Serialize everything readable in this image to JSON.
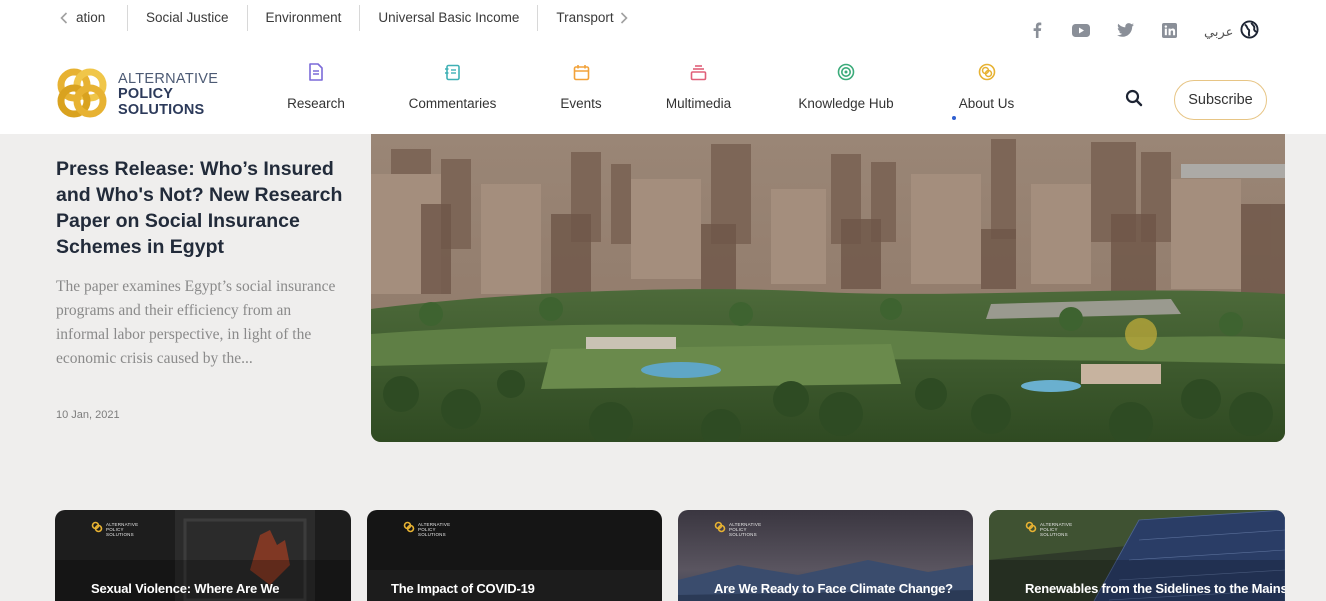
{
  "topics": {
    "items": [
      "ation",
      "Social Justice",
      "Environment",
      "Universal Basic Income",
      "Transport"
    ]
  },
  "social": {
    "icons": [
      "facebook-icon",
      "youtube-icon",
      "twitter-icon",
      "linkedin-icon"
    ],
    "language_label": "عربي"
  },
  "logo": {
    "line1": "ALTERNATIVE",
    "line2": "POLICY",
    "line3": "SOLUTIONS"
  },
  "nav": {
    "items": [
      {
        "label": "Research",
        "icon": "document-icon",
        "color": "#7b6ad8"
      },
      {
        "label": "Commentaries",
        "icon": "notebook-icon",
        "color": "#3fb0b5"
      },
      {
        "label": "Events",
        "icon": "calendar-icon",
        "color": "#f2a23a"
      },
      {
        "label": "Multimedia",
        "icon": "stack-icon",
        "color": "#e0607a"
      },
      {
        "label": "Knowledge Hub",
        "icon": "target-icon",
        "color": "#3bab7a"
      },
      {
        "label": "About Us",
        "icon": "logo-mark-icon",
        "color": "#e7b232"
      }
    ],
    "subscribe_label": "Subscribe"
  },
  "feature": {
    "title": "Press Release: Who’s Insured and Who's Not? New Research Paper on Social Insurance Schemes in Egypt",
    "excerpt": "The paper examines Egypt’s social insurance programs and their efficiency from an informal labor perspective, in light of the economic crisis caused by the...",
    "date": "10 Jan, 2021"
  },
  "cards": [
    {
      "title": "Sexual Violence: Where Are We",
      "logo_text": [
        "ALTERNATIVE",
        "POLICY",
        "SOLUTIONS"
      ]
    },
    {
      "title": "The Impact of COVID-19",
      "logo_text": [
        "ALTERNATIVE",
        "POLICY",
        "SOLUTIONS"
      ]
    },
    {
      "title": "Are We Ready to Face Climate Change?",
      "logo_text": [
        "ALTERNATIVE",
        "POLICY",
        "SOLUTIONS"
      ]
    },
    {
      "title": "Renewables from the Sidelines to the Mainstream:",
      "logo_text": [
        "ALTERNATIVE",
        "POLICY",
        "SOLUTIONS"
      ]
    }
  ],
  "colors": {
    "brand_gold": "#e7b232",
    "brand_navy": "#2c3a5a",
    "page_bg": "#efeeed",
    "subscribe_border": "#e7c585"
  }
}
